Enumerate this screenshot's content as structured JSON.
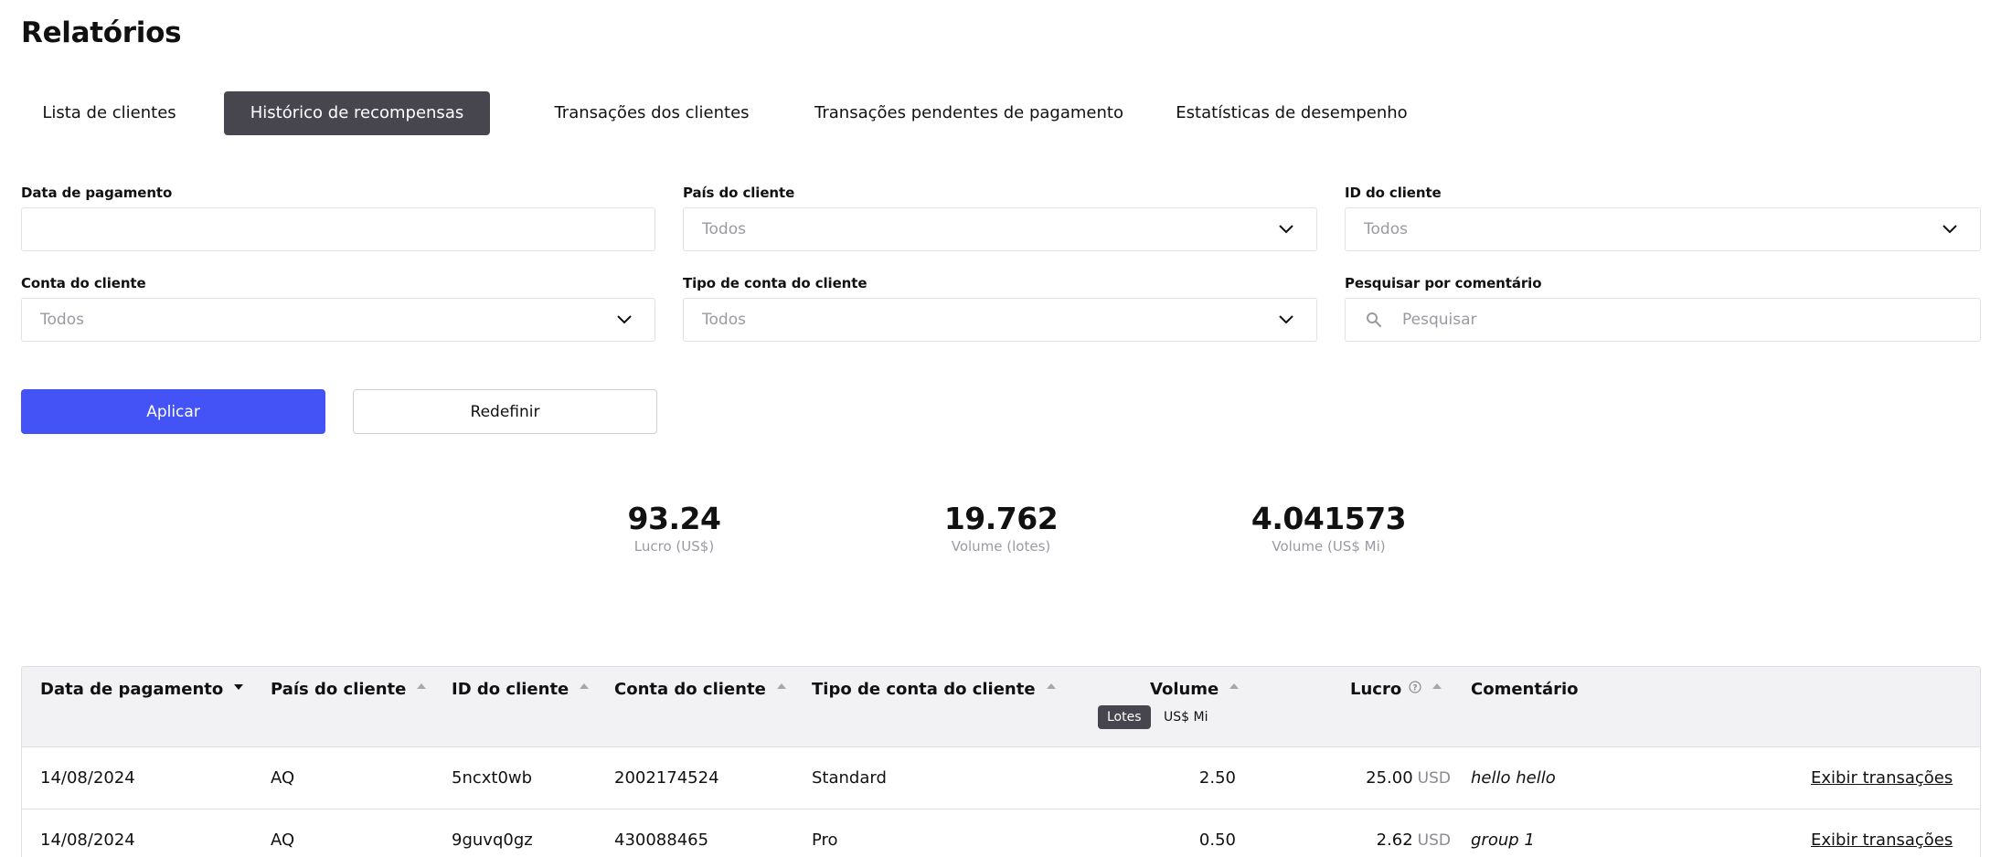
{
  "page": {
    "title": "Relatórios"
  },
  "tabs": [
    {
      "label": "Lista de clientes",
      "active": false
    },
    {
      "label": "Histórico de recompensas",
      "active": true
    },
    {
      "label": "Transações dos clientes",
      "active": false
    },
    {
      "label": "Transações pendentes de pagamento",
      "active": false
    },
    {
      "label": "Estatísticas de desempenho",
      "active": false
    }
  ],
  "filters": {
    "payment_date": {
      "label": "Data de pagamento",
      "value": ""
    },
    "client_country": {
      "label": "País do cliente",
      "value": "Todos"
    },
    "client_id": {
      "label": "ID do cliente",
      "value": "Todos"
    },
    "client_account": {
      "label": "Conta do cliente",
      "value": "Todos"
    },
    "client_account_type": {
      "label": "Tipo de conta do cliente",
      "value": "Todos"
    },
    "comment_search": {
      "label": "Pesquisar por comentário",
      "placeholder": "Pesquisar",
      "value": ""
    }
  },
  "actions": {
    "apply_label": "Aplicar",
    "reset_label": "Redefinir"
  },
  "summary": [
    {
      "value": "93.24",
      "label": "Lucro (US$)"
    },
    {
      "value": "19.762",
      "label": "Volume (lotes)"
    },
    {
      "value": "4.041573",
      "label": "Volume (US$ Mi)"
    }
  ],
  "table": {
    "columns": [
      {
        "label": "Data de pagamento",
        "sort": "desc"
      },
      {
        "label": "País do cliente",
        "sort": "asc"
      },
      {
        "label": "ID do cliente",
        "sort": "asc"
      },
      {
        "label": "Conta do cliente",
        "sort": "asc"
      },
      {
        "label": "Tipo de conta do cliente",
        "sort": "asc"
      },
      {
        "label": "Volume",
        "sort": "asc"
      },
      {
        "label": "Lucro",
        "sort": "asc"
      },
      {
        "label": "Comentário",
        "sort": "none"
      }
    ],
    "volume_units": {
      "lots": "Lotes",
      "usd_mi": "US$ Mi",
      "selected": "lots"
    },
    "rows": [
      {
        "payment_date": "14/08/2024",
        "country": "AQ",
        "client_id": "5ncxt0wb",
        "account": "2002174524",
        "account_type": "Standard",
        "volume": "2.50",
        "profit": "25.00",
        "currency": "USD",
        "comment": "hello hello",
        "action": "Exibir transações"
      },
      {
        "payment_date": "14/08/2024",
        "country": "AQ",
        "client_id": "9guvq0gz",
        "account": "430088465",
        "account_type": "Pro",
        "volume": "0.50",
        "profit": "2.62",
        "currency": "USD",
        "comment": "group 1",
        "action": "Exibir transações"
      }
    ]
  },
  "colors": {
    "primary": "#4353f5",
    "tab_active": "#47464f",
    "muted_text": "#9a9aa2"
  }
}
